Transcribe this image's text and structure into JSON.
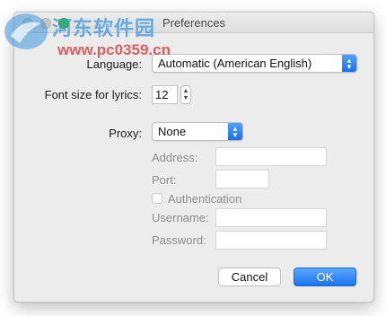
{
  "window": {
    "title": "Preferences"
  },
  "watermark": {
    "brand": "河东软件园",
    "url": "www.pc0359.cn"
  },
  "language": {
    "label": "Language:",
    "value": "Automatic (American English)"
  },
  "font_size": {
    "label": "Font size for lyrics:",
    "value": "12"
  },
  "proxy": {
    "label": "Proxy:",
    "value": "None",
    "address_label": "Address:",
    "address_value": "",
    "port_label": "Port:",
    "port_value": "",
    "auth_label": "Authentication",
    "username_label": "Username:",
    "username_value": "",
    "password_label": "Password:",
    "password_value": ""
  },
  "buttons": {
    "cancel": "Cancel",
    "ok": "OK"
  },
  "colors": {
    "accent": "#1b73f0",
    "zoom": "#2dbb3f",
    "watermark_blue": "#3c96dc",
    "watermark_red": "#d73c3c"
  }
}
